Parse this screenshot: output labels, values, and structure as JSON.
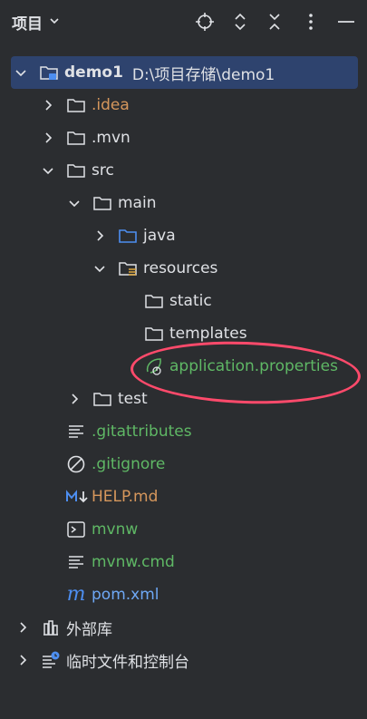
{
  "header": {
    "title": "项目",
    "icons": [
      "locate-icon",
      "expand-icon",
      "collapse-icon",
      "more-icon",
      "minimize-icon"
    ]
  },
  "tree": {
    "root": {
      "name": "demo1",
      "path": "D:\\项目存储\\demo1"
    },
    "items": [
      {
        "label": ".idea",
        "color": "#d6975c"
      },
      {
        "label": ".mvn"
      },
      {
        "label": "src"
      },
      {
        "label": "main"
      },
      {
        "label": "java"
      },
      {
        "label": "resources"
      },
      {
        "label": "static"
      },
      {
        "label": "templates"
      },
      {
        "label": "application.properties",
        "color": "#5fb865"
      },
      {
        "label": "test"
      },
      {
        "label": ".gitattributes",
        "color": "#5fb865"
      },
      {
        "label": ".gitignore",
        "color": "#5fb865"
      },
      {
        "label": "HELP.md",
        "color": "#d6975c"
      },
      {
        "label": "mvnw",
        "color": "#5fb865"
      },
      {
        "label": "mvnw.cmd",
        "color": "#5fb865"
      },
      {
        "label": "pom.xml",
        "color": "#4d8ef0"
      },
      {
        "label": "外部库"
      },
      {
        "label": "临时文件和控制台"
      }
    ]
  }
}
